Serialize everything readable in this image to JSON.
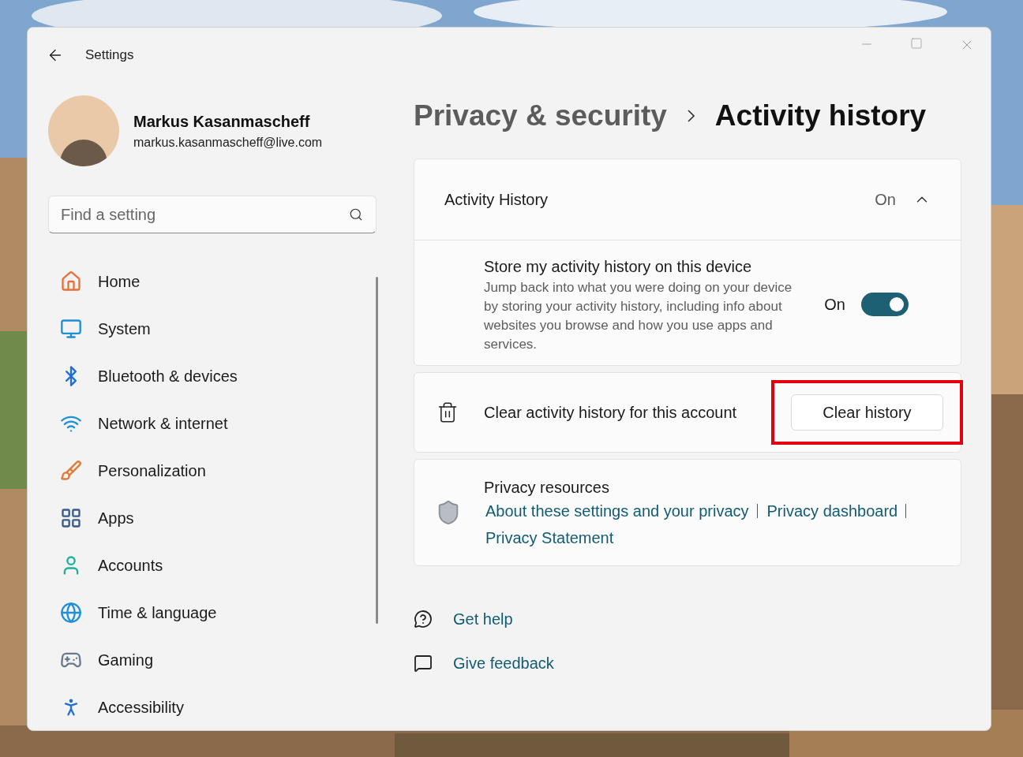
{
  "window": {
    "title": "Settings"
  },
  "profile": {
    "name": "Markus Kasanmascheff",
    "email": "markus.kasanmascheff@live.com"
  },
  "search": {
    "placeholder": "Find a setting"
  },
  "nav": [
    {
      "label": "Home"
    },
    {
      "label": "System"
    },
    {
      "label": "Bluetooth & devices"
    },
    {
      "label": "Network & internet"
    },
    {
      "label": "Personalization"
    },
    {
      "label": "Apps"
    },
    {
      "label": "Accounts"
    },
    {
      "label": "Time & language"
    },
    {
      "label": "Gaming"
    },
    {
      "label": "Accessibility"
    }
  ],
  "breadcrumb": [
    "Privacy & security",
    "Activity history"
  ],
  "activity_history": {
    "title": "Activity History",
    "status": "On",
    "expanded": true,
    "store": {
      "title": "Store my activity history on this device",
      "description": "Jump back into what you were doing on your device by storing your activity history, including info about websites you browse and how you use apps and services.",
      "toggle_label": "On",
      "on": true
    }
  },
  "clear": {
    "label": "Clear activity history for this account",
    "button": "Clear history",
    "highlighted": true
  },
  "resources": {
    "title": "Privacy resources",
    "links": [
      "About these settings and your privacy",
      "Privacy dashboard",
      "Privacy Statement"
    ]
  },
  "help_links": [
    "Get help",
    "Give feedback"
  ]
}
